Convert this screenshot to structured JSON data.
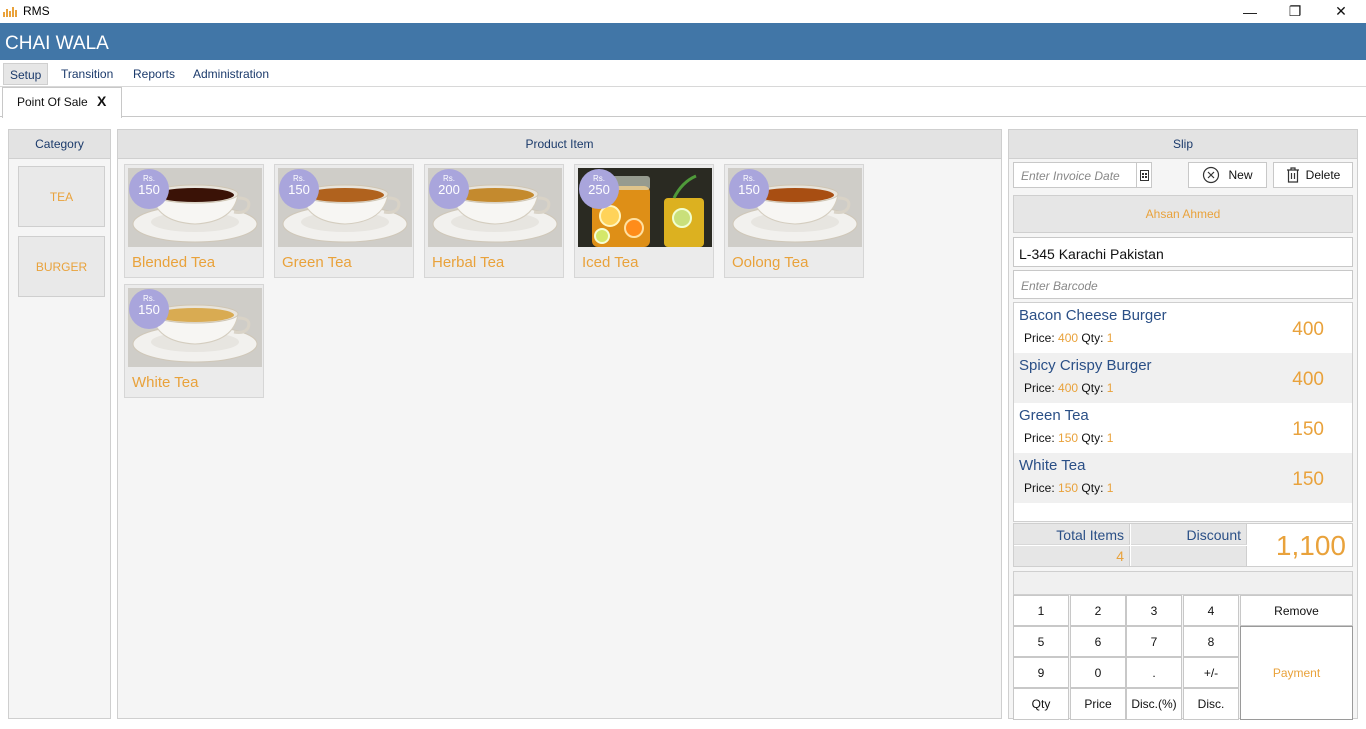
{
  "window": {
    "app_title": "RMS",
    "minimize": "—",
    "restore": "❐",
    "close": "✕"
  },
  "banner": {
    "title": "CHAI WALA"
  },
  "menu": [
    "Setup",
    "Transition",
    "Reports",
    "Administration"
  ],
  "tab": {
    "label": "Point Of Sale",
    "close": "X"
  },
  "category": {
    "header": "Category",
    "items": [
      "TEA",
      "BURGER"
    ]
  },
  "products": {
    "header": "Product Item",
    "items": [
      {
        "name": "Blended Tea",
        "currency": "Rs.",
        "price": "150",
        "image": "tea-cup",
        "tea_color": "#3a1206"
      },
      {
        "name": "Green Tea",
        "currency": "Rs.",
        "price": "150",
        "image": "tea-cup",
        "tea_color": "#b0621e"
      },
      {
        "name": "Herbal Tea",
        "currency": "Rs.",
        "price": "200",
        "image": "tea-cup",
        "tea_color": "#c48a2e"
      },
      {
        "name": "Iced Tea",
        "currency": "Rs.",
        "price": "250",
        "image": "iced-tea-pitcher",
        "tea_color": "#f0a020"
      },
      {
        "name": "Oolong Tea",
        "currency": "Rs.",
        "price": "150",
        "image": "tea-cup",
        "tea_color": "#a84e12"
      },
      {
        "name": "White Tea",
        "currency": "Rs.",
        "price": "150",
        "image": "tea-cup",
        "tea_color": "#d9ab52"
      }
    ]
  },
  "slip": {
    "header": "Slip",
    "invoice_date_placeholder": "Enter Invoice Date",
    "new_label": "New",
    "delete_label": "Delete",
    "customer": "Ahsan Ahmed",
    "address": "L-345 Karachi Pakistan",
    "barcode_placeholder": "Enter Barcode",
    "price_label": "Price:",
    "qty_label": "Qty:",
    "lines": [
      {
        "name": "Bacon Cheese Burger",
        "price": "400",
        "qty": "1",
        "total": "400"
      },
      {
        "name": "Spicy Crispy Burger",
        "price": "400",
        "qty": "1",
        "total": "400"
      },
      {
        "name": "Green Tea",
        "price": "150",
        "qty": "1",
        "total": "150"
      },
      {
        "name": "White Tea",
        "price": "150",
        "qty": "1",
        "total": "150"
      }
    ],
    "total_items_label": "Total Items",
    "total_items": "4",
    "discount_label": "Discount",
    "discount_value": "",
    "grand_total": "1,100",
    "keypad": {
      "keys": [
        "1",
        "2",
        "3",
        "4",
        "5",
        "6",
        "7",
        "8",
        "9",
        "0",
        ".",
        "+/-"
      ],
      "modes": [
        "Qty",
        "Price",
        "Disc.(%)",
        "Disc."
      ],
      "remove": "Remove",
      "payment": "Payment"
    }
  },
  "colors": {
    "brand_blue": "#4176a7",
    "accent_orange": "#e9a23b",
    "badge_purple": "#a9a5dc",
    "text_navy": "#2a4f86"
  }
}
